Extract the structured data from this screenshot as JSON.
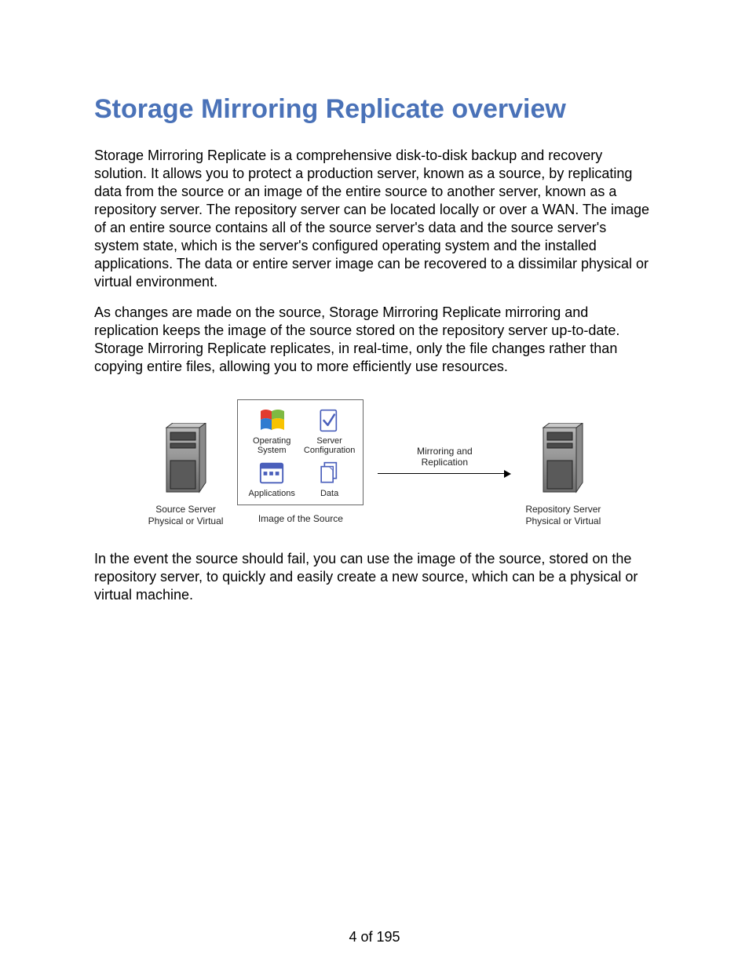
{
  "title": "Storage Mirroring Replicate overview",
  "paragraphs": {
    "p1": "Storage Mirroring Replicate is a comprehensive disk-to-disk backup and recovery solution. It allows you to protect a production server, known as a source, by replicating data from the source or an image of the entire source to another server, known as a repository server. The repository server can be located locally or over a WAN. The image of an entire source contains all of the source server's data and the source server's system state, which is the server's configured operating system and the installed applications. The data or entire server image can be recovered to a dissimilar physical or virtual environment.",
    "p2": "As changes are made on the source, Storage Mirroring Replicate mirroring and replication keeps the image of the source stored on the repository server up-to-date. Storage Mirroring Replicate replicates, in real-time, only the file changes rather than copying entire files, allowing you to more efficiently use resources.",
    "p3": "In the event the source should fail, you can use the image of the source, stored on the repository server, to quickly and easily create a new source, which can be a physical or virtual machine."
  },
  "diagram": {
    "source_server": {
      "line1": "Source Server",
      "line2": "Physical or Virtual"
    },
    "source_image": {
      "caption": "Image of the Source",
      "items": {
        "os": {
          "line1": "Operating",
          "line2": "System"
        },
        "config": {
          "line1": "Server",
          "line2": "Configuration"
        },
        "apps": {
          "label": "Applications"
        },
        "data": {
          "label": "Data"
        }
      }
    },
    "arrow": {
      "line1": "Mirroring and",
      "line2": "Replication"
    },
    "repo_server": {
      "line1": "Repository Server",
      "line2": "Physical or Virtual"
    }
  },
  "page_number": "4 of 195"
}
